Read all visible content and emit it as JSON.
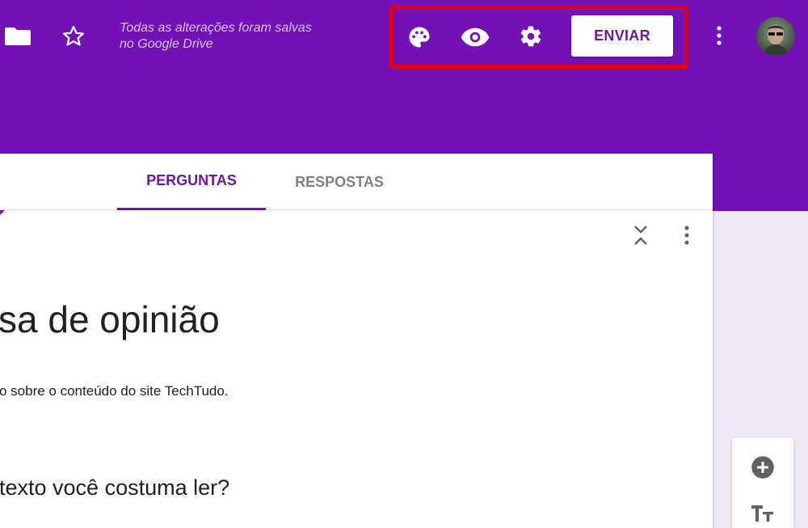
{
  "header": {
    "saved_status": "Todas as alterações foram salvas no Google Drive",
    "send_label": "ENVIAR",
    "icons": {
      "folder": "folder-icon",
      "star": "star-icon",
      "palette": "palette-icon",
      "preview": "eye-icon",
      "settings": "gear-icon",
      "more": "more-vert-icon",
      "avatar": "avatar"
    }
  },
  "tabs": [
    {
      "label": "PERGUNTAS",
      "active": true
    },
    {
      "label": "RESPOSTAS",
      "active": false
    }
  ],
  "form": {
    "title": "sa de opinião",
    "description": "o sobre o conteúdo do site TechTudo.",
    "question_title": "texto você costuma ler?"
  },
  "side_toolbar": {
    "icons": [
      "add-circle-icon",
      "text-size-icon"
    ]
  },
  "colors": {
    "header_purple": "#7211b6",
    "accent_text": "#6a1b9a",
    "background_lavender": "#ede7f6",
    "highlight_red": "#e0000f"
  }
}
